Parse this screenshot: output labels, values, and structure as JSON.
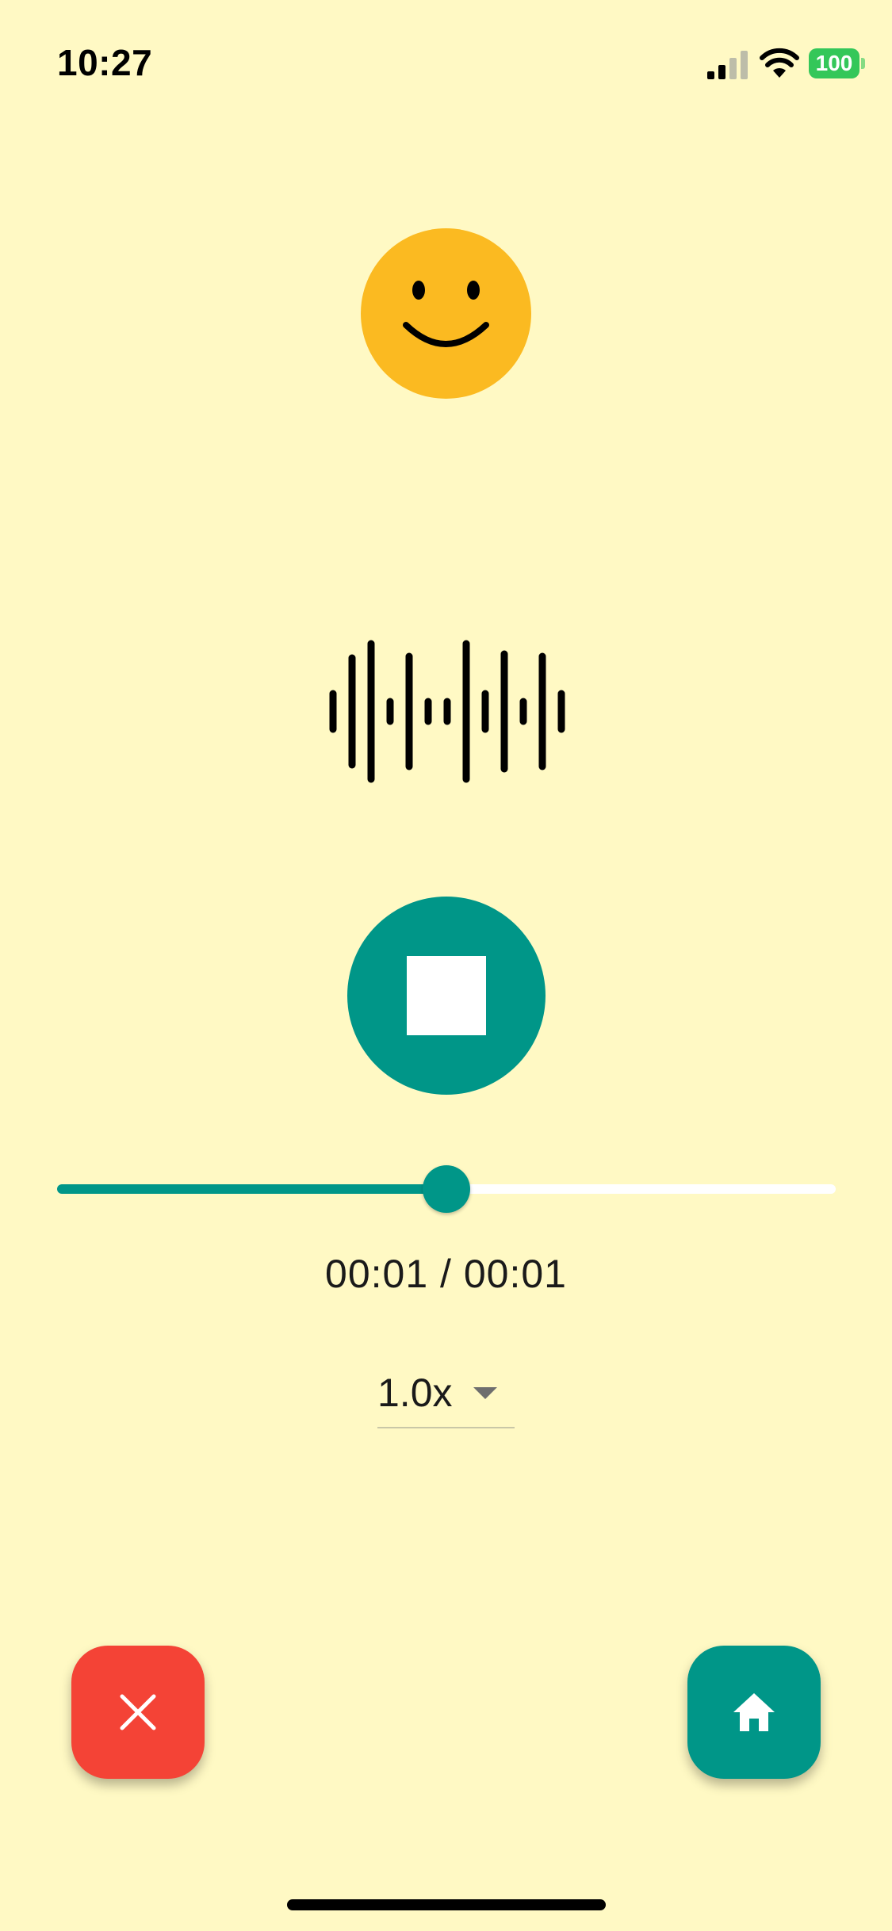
{
  "status_bar": {
    "time": "10:27",
    "battery_level": "100",
    "signal_bars_active": 2,
    "signal_bars_total": 4
  },
  "emoji": {
    "icon": "smiling-face-icon",
    "color": "#FBBA21"
  },
  "waveform": {
    "icon": "audio-waveform-icon"
  },
  "playback": {
    "stop_icon": "stop-icon",
    "progress": 0.5,
    "time_readout": "00:01 / 00:01",
    "speed_label": "1.0x"
  },
  "actions": {
    "close_icon": "close-icon",
    "home_icon": "home-icon"
  },
  "colors": {
    "background": "#FFF9C4",
    "accent": "#009688",
    "danger": "#F44336",
    "battery": "#34C759"
  }
}
